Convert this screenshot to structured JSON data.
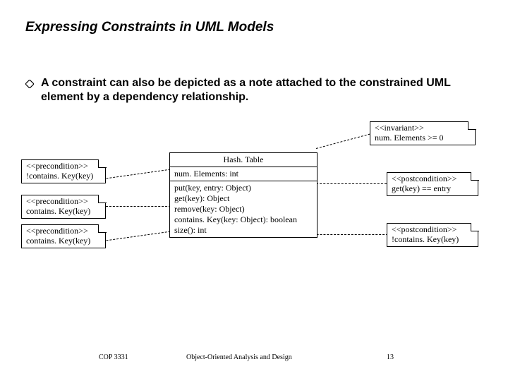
{
  "title": "Expressing Constraints in UML Models",
  "bullet": "A constraint can also be depicted as a note attached to the constrained UML element by a dependency relationship.",
  "notes": {
    "invariant": {
      "stereo": "<<invariant>>",
      "expr": "num. Elements >= 0"
    },
    "pre1": {
      "stereo": "<<precondition>>",
      "expr": "!contains. Key(key)"
    },
    "pre2": {
      "stereo": "<<precondition>>",
      "expr": "contains. Key(key)"
    },
    "pre3": {
      "stereo": "<<precondition>>",
      "expr": "contains. Key(key)"
    },
    "post1": {
      "stereo": "<<postcondition>>",
      "expr": "get(key) == entry"
    },
    "post2": {
      "stereo": "<<postcondition>>",
      "expr": "!contains. Key(key)"
    }
  },
  "uml": {
    "name": "Hash. Table",
    "attribute": "num. Elements: int",
    "ops": [
      "put(key, entry: Object)",
      "get(key): Object",
      "remove(key: Object)",
      "contains. Key(key: Object): boolean",
      "size(): int"
    ]
  },
  "footer": {
    "left": "COP 3331",
    "center": "Object-Oriented Analysis and Design",
    "right": "13"
  }
}
